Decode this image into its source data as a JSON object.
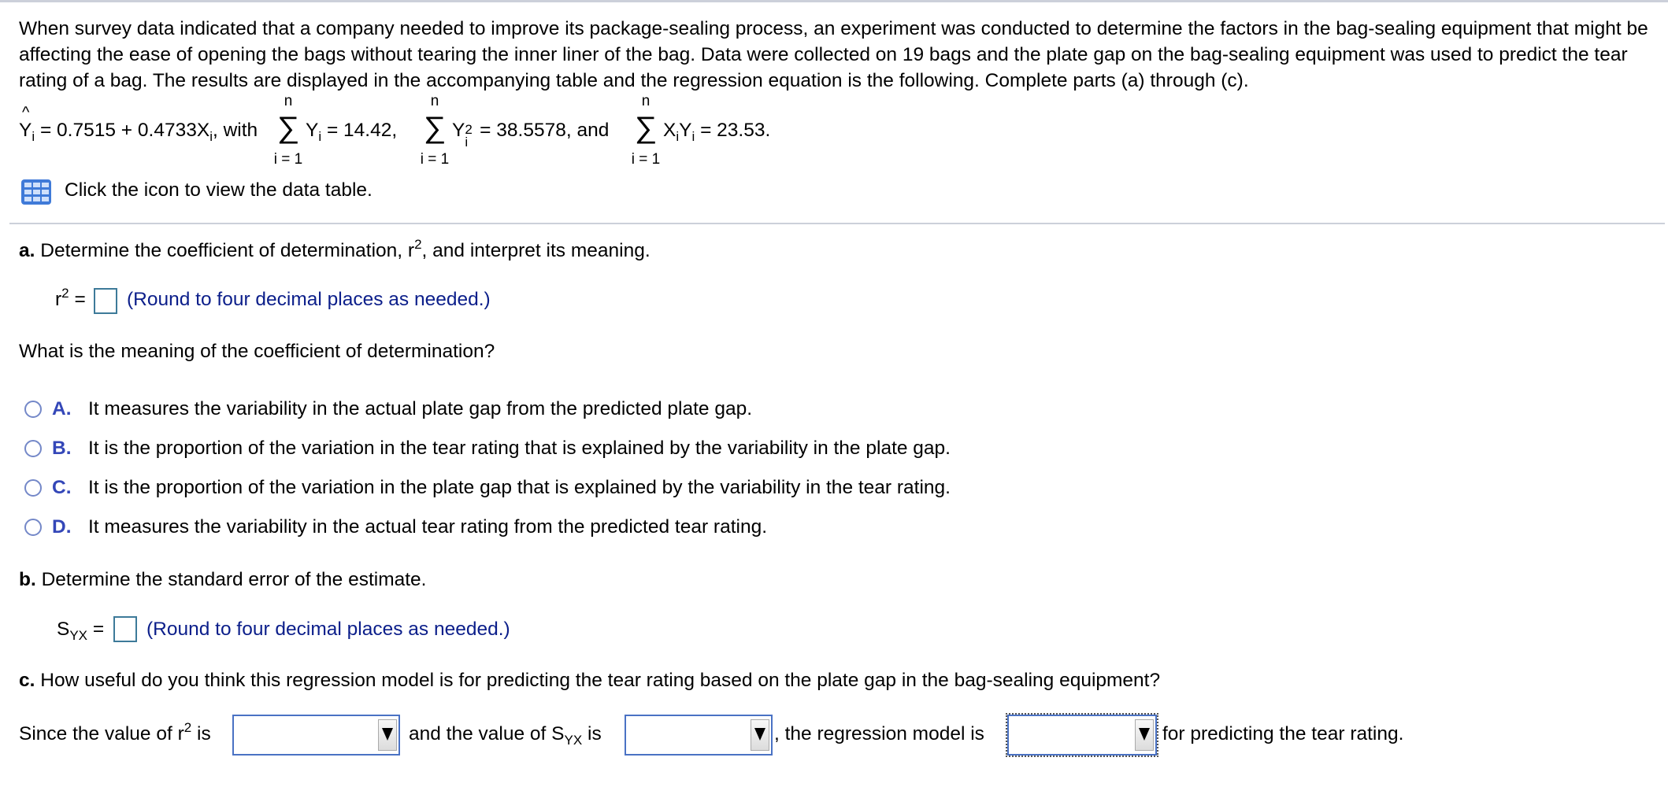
{
  "intro": {
    "text": "When survey data indicated that a company needed to improve its package-sealing process, an experiment was conducted to determine the factors in the bag-sealing equipment that might be affecting the ease of opening the bags without tearing the inner liner of the bag. Data were collected on 19 bags and the plate gap on the bag-sealing equipment was used to predict the tear rating of a bag. The results are displayed in the accompanying table and the regression equation is the following. Complete parts (a) through (c)."
  },
  "formula": {
    "yhat": "Y",
    "yhat_sub": "i",
    "equation": "= 0.7515 + 0.4733X",
    "equation_sub": "i",
    "with": ", with",
    "sum_upper": "n",
    "sum_symbol": "∑",
    "sum_lower": "i = 1",
    "sum1_var": "Y",
    "sum1_sub": "i",
    "sum1_value": "= 14.42,",
    "sum2_var": "Y",
    "sum2_sup": "2",
    "sum2_sub": "i",
    "sum2_value": "= 38.5578, and",
    "sum3_var": "X",
    "sum3_sub1": "i",
    "sum3_var2": "Y",
    "sum3_sub2": "i",
    "sum3_value": "= 23.53."
  },
  "data_table_link": {
    "icon": "table-icon",
    "text": "Click the icon to view the data table."
  },
  "part_a": {
    "label": "a.",
    "question": " Determine the coefficient of determination, r",
    "question_sup": "2",
    "question_end": ", and interpret its meaning.",
    "answer_label": "r",
    "answer_sup": "2",
    "answer_eq": "=",
    "answer_value": "",
    "hint": "(Round to four decimal places as needed.)",
    "meaning_question": "What is the meaning of the coefficient of determination?",
    "options": [
      {
        "letter": "A.",
        "text": "It measures the variability in the actual plate gap from the predicted plate gap."
      },
      {
        "letter": "B.",
        "text": "It is the proportion of the variation in the tear rating that is explained by the variability in the plate gap."
      },
      {
        "letter": "C.",
        "text": "It is the proportion of the variation in the plate gap that is explained by the variability in the tear rating."
      },
      {
        "letter": "D.",
        "text": "It measures the variability in the actual tear rating from the predicted tear rating."
      }
    ]
  },
  "part_b": {
    "label": "b.",
    "question": " Determine the standard error of the estimate.",
    "answer_label": "S",
    "answer_sub": "YX",
    "answer_eq": "=",
    "answer_value": "",
    "hint": "(Round to four decimal places as needed.)"
  },
  "part_c": {
    "label": "c.",
    "question": " How useful do you think this regression model is for predicting the tear rating based on the plate gap in the bag-sealing equipment?",
    "sentence_1": "Since the value of r",
    "sentence_1_sup": "2",
    "sentence_1_end": " is",
    "sentence_2": "and the value of S",
    "sentence_2_sub": "YX",
    "sentence_2_end": " is",
    "sentence_3": ", the regression model is",
    "sentence_4": "for predicting the tear rating.",
    "dropdown_1_value": "",
    "dropdown_2_value": "",
    "dropdown_3_value": ""
  }
}
